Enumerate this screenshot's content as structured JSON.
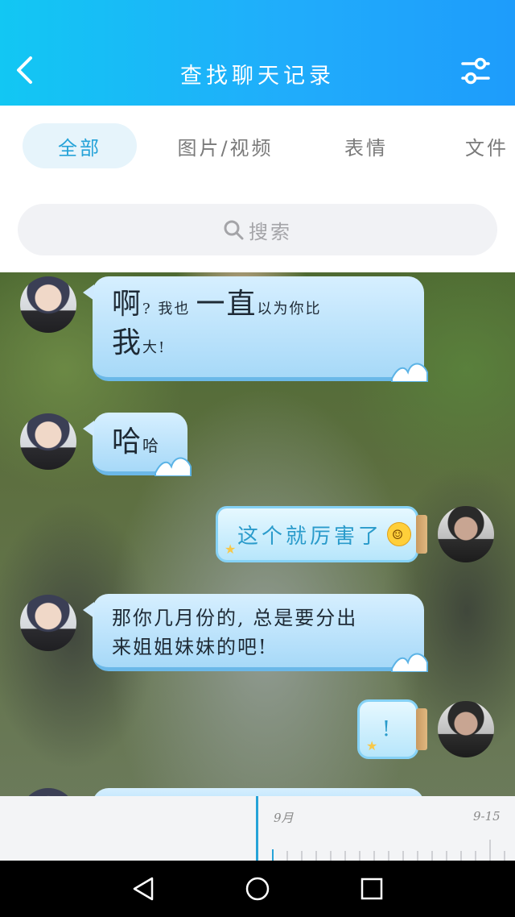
{
  "header": {
    "title": "查找聊天记录",
    "back_icon": "chevron-left-icon",
    "filter_icon": "sliders-icon",
    "gradient": [
      "#12c7f3",
      "#1e9cfb"
    ]
  },
  "tabs": [
    {
      "label": "全部",
      "active": true
    },
    {
      "label": "图片/视频",
      "active": false
    },
    {
      "label": "表情",
      "active": false
    },
    {
      "label": "文件",
      "active": false
    }
  ],
  "search": {
    "placeholder": "搜索",
    "icon": "search-icon"
  },
  "messages": [
    {
      "side": "left",
      "parts": [
        "啊",
        "? 我也",
        "一直",
        "以为你比",
        "我",
        "大!"
      ]
    },
    {
      "side": "left",
      "parts": [
        "哈",
        "哈"
      ]
    },
    {
      "side": "right",
      "text": "这个就厉害了",
      "emoji": "laughing-tears-emoji"
    },
    {
      "side": "left",
      "lines": [
        "那你几月份的, 总是要分出",
        "来姐姐妹妹的吧!"
      ]
    },
    {
      "side": "right",
      "text": "!"
    }
  ],
  "timeline": {
    "labels": [
      "9月",
      "9-15"
    ]
  },
  "system_nav": {
    "back": "back-triangle-icon",
    "home": "home-circle-icon",
    "recents": "recents-square-icon"
  },
  "colors": {
    "accent": "#26a3d8",
    "bubble": "#a7d9f8"
  }
}
